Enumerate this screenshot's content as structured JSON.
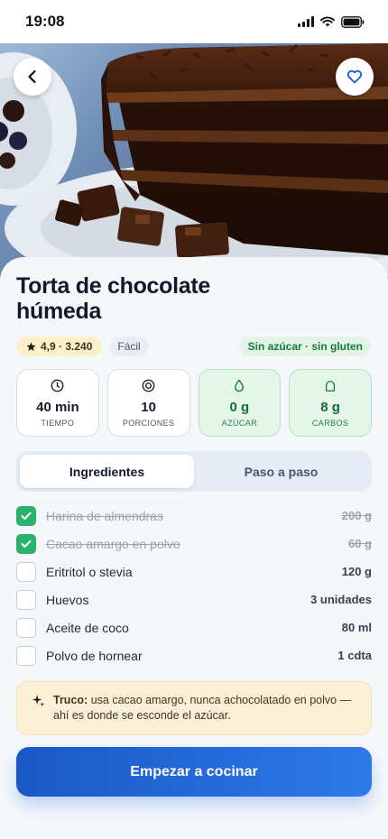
{
  "status_bar": {
    "time": "19:08"
  },
  "recipe": {
    "title": "Torta de chocolate húmeda",
    "rating": "4,9 · 3.240",
    "difficulty": "Fácil",
    "tags": "Sin azúcar · sin gluten"
  },
  "stats": [
    {
      "icon": "clock-icon",
      "value": "40 min",
      "label": "TIEMPO"
    },
    {
      "icon": "servings-icon",
      "value": "10",
      "label": "PORCIONES"
    },
    {
      "icon": "drop-icon",
      "value": "0 g",
      "label": "AZÚCAR"
    },
    {
      "icon": "carbs-icon",
      "value": "8 g",
      "label": "CARBOS"
    }
  ],
  "tabs": [
    {
      "label": "Ingredientes",
      "active": true
    },
    {
      "label": "Paso a paso",
      "active": false
    }
  ],
  "ingredients": [
    {
      "name": "Harina de almendras",
      "quantity": "200 g",
      "checked": true
    },
    {
      "name": "Cacao amargo en polvo",
      "quantity": "60 g",
      "checked": true
    },
    {
      "name": "Eritritol o stevia",
      "quantity": "120 g",
      "checked": false
    },
    {
      "name": "Huevos",
      "quantity": "3 unidades",
      "checked": false
    },
    {
      "name": "Aceite de coco",
      "quantity": "80 ml",
      "checked": false
    },
    {
      "name": "Polvo de hornear",
      "quantity": "1 cdta",
      "checked": false
    }
  ],
  "tip": {
    "label": "Truco:",
    "text": "usa cacao amargo, nunca achocolatado en polvo — ahí es donde se esconde el azúcar."
  },
  "cta": {
    "label": "Empezar a cocinar"
  },
  "colors": {
    "accent": "#1f63d6",
    "success": "#2bb36b",
    "tip_background": "#fcf1d6"
  }
}
